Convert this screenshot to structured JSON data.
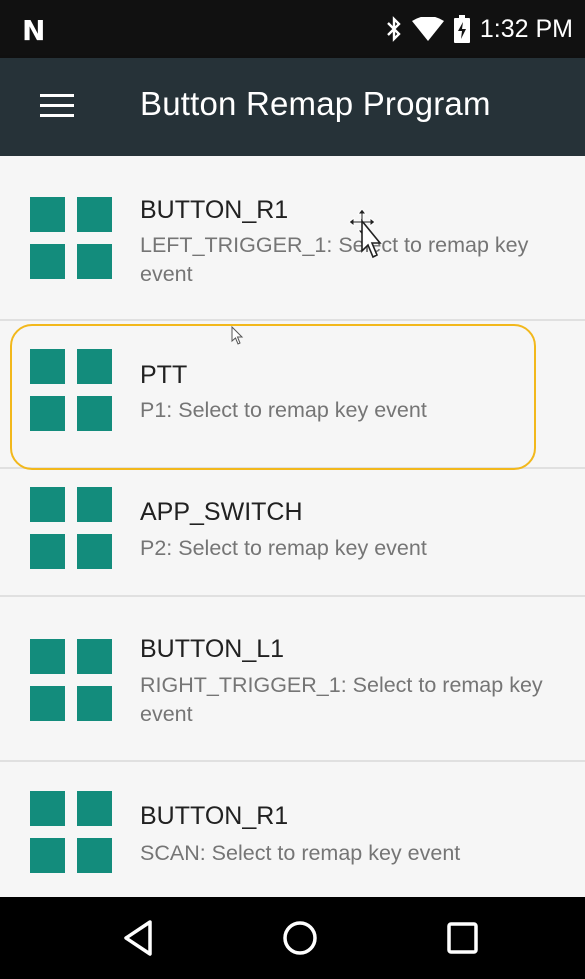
{
  "status_bar": {
    "notification_icon": "N",
    "icons": [
      "bluetooth-icon",
      "wifi-icon",
      "battery-icon"
    ],
    "time": "1:32 PM"
  },
  "app_bar": {
    "menu_icon": "hamburger-menu-icon",
    "title": "Button Remap Program"
  },
  "items": [
    {
      "title": "BUTTON_R1",
      "subtitle": "LEFT_TRIGGER_1: Select to remap key event"
    },
    {
      "title": "PTT",
      "subtitle": "P1: Select to remap key event"
    },
    {
      "title": "APP_SWITCH",
      "subtitle": "P2: Select to remap key event"
    },
    {
      "title": "BUTTON_L1",
      "subtitle": "RIGHT_TRIGGER_1: Select to remap key event"
    },
    {
      "title": "BUTTON_R1",
      "subtitle": "SCAN: Select to remap key event"
    }
  ],
  "nav_bar": {
    "buttons": [
      "back-icon",
      "home-icon",
      "recents-icon"
    ]
  },
  "colors": {
    "app_bar": "#263238",
    "icon_teal": "#138c7c",
    "highlight": "#f2b81c",
    "status_bar": "#111111"
  }
}
